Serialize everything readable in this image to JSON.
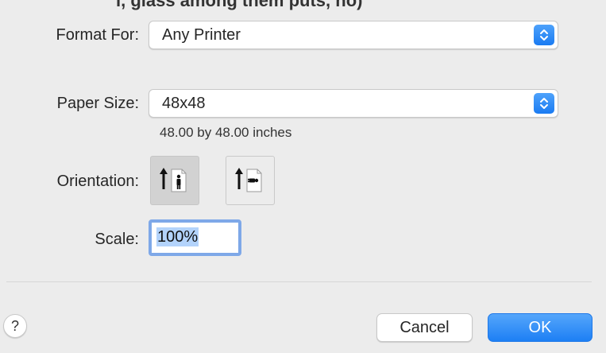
{
  "header": {
    "cropped_text": "l, glass among them puts, no)"
  },
  "format_for": {
    "label": "Format For:",
    "value": "Any Printer",
    "stepper_icon": "up-down-chevron-icon"
  },
  "paper_size": {
    "label": "Paper Size:",
    "value": "48x48",
    "description": "48.00 by 48.00 inches",
    "stepper_icon": "up-down-chevron-icon"
  },
  "orientation": {
    "label": "Orientation:",
    "options": [
      {
        "name": "portrait",
        "icon": "portrait-orientation-icon",
        "selected": true
      },
      {
        "name": "landscape",
        "icon": "landscape-orientation-icon",
        "selected": false
      }
    ]
  },
  "scale": {
    "label": "Scale:",
    "value": "100%"
  },
  "footer": {
    "help_label": "?",
    "cancel_label": "Cancel",
    "ok_label": "OK"
  },
  "colors": {
    "accent": "#1d7ff4",
    "background": "#ececec",
    "focus_ring": "#7ea8e8",
    "selection": "#b3d3fb"
  }
}
